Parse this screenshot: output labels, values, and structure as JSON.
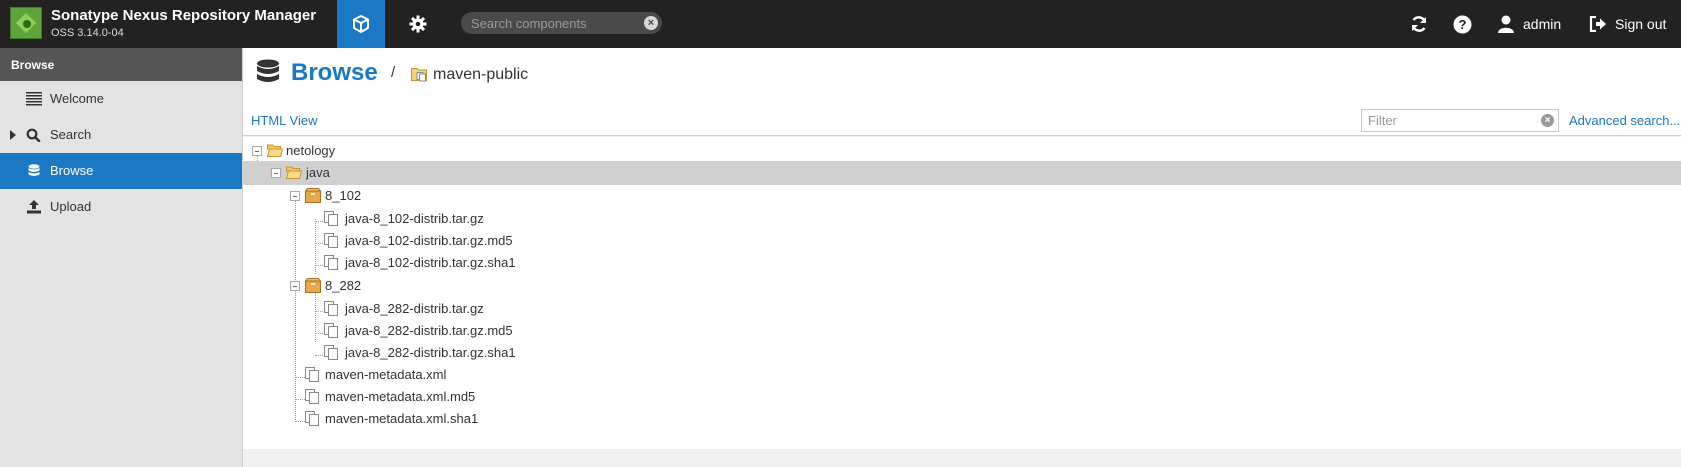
{
  "header": {
    "app_title": "Sonatype Nexus Repository Manager",
    "app_version": "OSS 3.14.0-04",
    "search_placeholder": "Search components",
    "user_label": "admin",
    "signout_label": "Sign out"
  },
  "sidebar": {
    "header": "Browse",
    "items": [
      {
        "label": "Welcome",
        "icon": "list-icon"
      },
      {
        "label": "Search",
        "icon": "search-icon"
      },
      {
        "label": "Browse",
        "icon": "database-icon"
      },
      {
        "label": "Upload",
        "icon": "upload-icon"
      }
    ]
  },
  "main": {
    "title": "Browse",
    "breadcrumb_sep": "/",
    "repository": "maven-public",
    "html_view": "HTML View",
    "filter_placeholder": "Filter",
    "advanced_search": "Advanced search...",
    "tree": [
      {
        "label": "netology",
        "kind": "folder-open",
        "expanded": true,
        "selected": false
      },
      {
        "label": "java",
        "kind": "folder-open",
        "expanded": true,
        "selected": true
      },
      {
        "label": "8_102",
        "kind": "component",
        "expanded": true,
        "selected": false
      },
      {
        "label": "java-8_102-distrib.tar.gz",
        "kind": "asset",
        "selected": false
      },
      {
        "label": "java-8_102-distrib.tar.gz.md5",
        "kind": "asset",
        "selected": false
      },
      {
        "label": "java-8_102-distrib.tar.gz.sha1",
        "kind": "asset",
        "selected": false
      },
      {
        "label": "8_282",
        "kind": "component",
        "expanded": true,
        "selected": false
      },
      {
        "label": "java-8_282-distrib.tar.gz",
        "kind": "asset",
        "selected": false
      },
      {
        "label": "java-8_282-distrib.tar.gz.md5",
        "kind": "asset",
        "selected": false
      },
      {
        "label": "java-8_282-distrib.tar.gz.sha1",
        "kind": "asset",
        "selected": false
      },
      {
        "label": "maven-metadata.xml",
        "kind": "asset",
        "selected": false
      },
      {
        "label": "maven-metadata.xml.md5",
        "kind": "asset",
        "selected": false
      },
      {
        "label": "maven-metadata.xml.sha1",
        "kind": "asset",
        "selected": false
      }
    ]
  },
  "colors": {
    "accent": "#1b78c4",
    "header_bg": "#222222",
    "sidebar_bg": "#e3e3e3",
    "selected_row": "#d0d0d0"
  }
}
